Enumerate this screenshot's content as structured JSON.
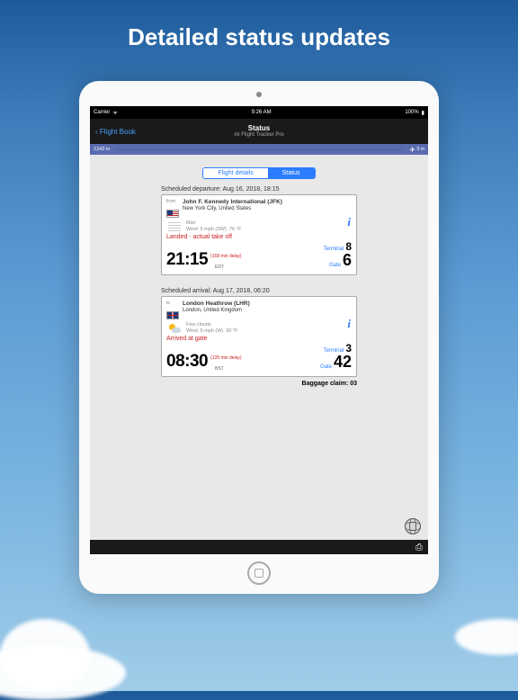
{
  "headline": "Detailed status updates",
  "statusbar": {
    "carrier": "Carrier",
    "wifi": "ᯤ",
    "time": "9:26 AM",
    "battery": "100%"
  },
  "nav": {
    "back": "Flight Book",
    "title": "Status",
    "subtitle": "mi Flight Tracker Pro"
  },
  "progress": {
    "left": "3,542 m",
    "right": "0 m"
  },
  "segments": {
    "flight_details": "Flight details",
    "status": "Status"
  },
  "departure": {
    "sched": "Scheduled departure: Aug 16, 2018, 18:15",
    "direction": "from",
    "airport": "John F. Kennedy International (JFK)",
    "city": "New York City, United States",
    "weather_cond": "Mist",
    "wind": "Wind: 6 mph (SW)",
    "temp": "76 °F",
    "status": "Landed - actual take off",
    "time": "21:15",
    "tz": "EDT",
    "delay": "(168 min delay)",
    "terminal_label": "Terminal",
    "terminal": "8",
    "gate_label": "Gate",
    "gate": "6"
  },
  "arrival": {
    "sched": "Scheduled arrival: Aug 17, 2018, 06:20",
    "direction": "to",
    "airport": "London Heathrow (LHR)",
    "city": "London, United Kingdom",
    "weather_cond": "Few clouds",
    "wind": "Wind: 6 mph (W)",
    "temp": "60 °F",
    "status": "Arrived at gate",
    "time": "08:30",
    "tz": "BST",
    "delay": "(135 min delay)",
    "terminal_label": "Terminal",
    "terminal": "3",
    "gate_label": "Gate",
    "gate": "42"
  },
  "baggage": "Baggage claim: 03"
}
